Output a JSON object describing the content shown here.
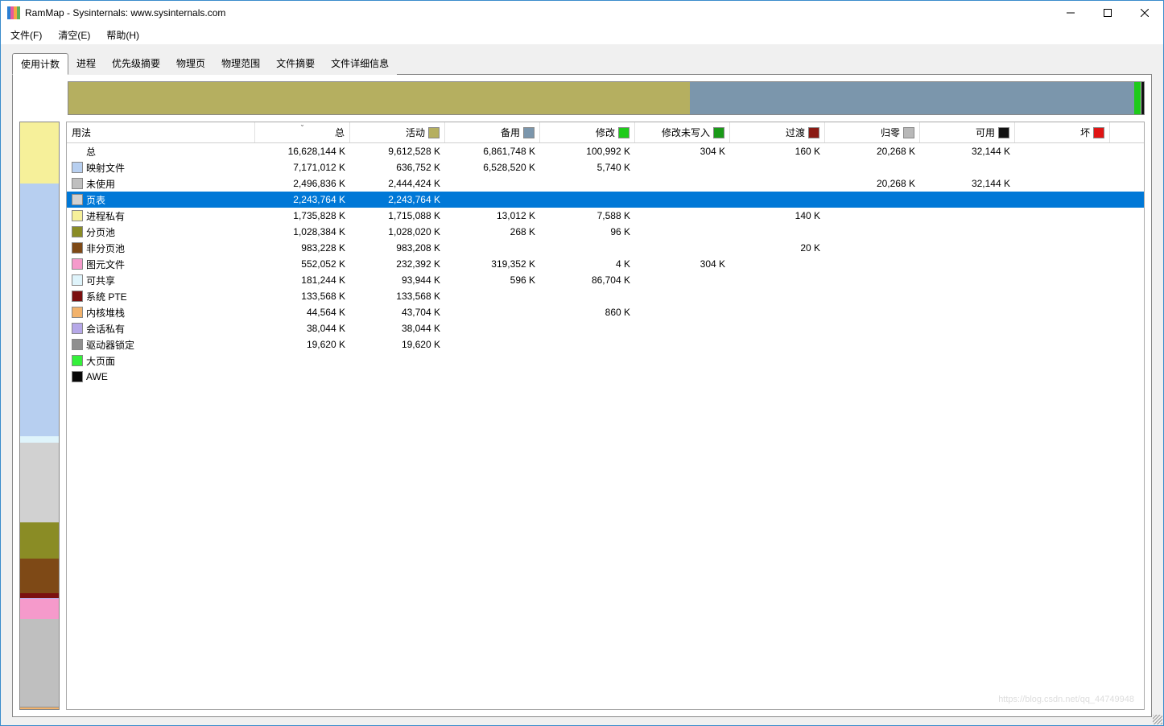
{
  "window": {
    "title": "RamMap - Sysinternals: www.sysinternals.com"
  },
  "menubar": {
    "file": "文件(F)",
    "empty": "清空(E)",
    "help": "帮助(H)"
  },
  "tabs": {
    "use_counts": "使用计数",
    "processes": "进程",
    "priority_summary": "优先级摘要",
    "physical_pages": "物理页",
    "physical_ranges": "物理范围",
    "file_summary": "文件摘要",
    "file_details": "文件详细信息"
  },
  "headers": {
    "usage": "用法",
    "total": "总",
    "active": "活动",
    "standby": "备用",
    "modified": "修改",
    "modified_nowrite": "修改未写入",
    "transition": "过渡",
    "zeroed": "归零",
    "free": "可用",
    "bad": "坏"
  },
  "colors": {
    "active": "#b5af60",
    "standby": "#7b96ac",
    "modified": "#1ecb1a",
    "modified_nowrite": "#1a9a18",
    "transition": "#8a1a13",
    "zeroed": "#b8b8b8",
    "free": "#111111",
    "bad": "#e01414",
    "mapped_file": "#b7cff0",
    "unused": "#bfbfbf",
    "page_table": "#d1d1d1",
    "process_private": "#f6f09a",
    "paged_pool": "#8a8c25",
    "nonpaged_pool": "#7e4916",
    "metafile": "#f59acb",
    "shareable": "#dff4fb",
    "system_pte": "#7b1010",
    "kernel_stack": "#f2b26b",
    "session_private": "#b6a8e8",
    "driver_locked": "#8f8f8f",
    "large_page": "#34f03a",
    "awe": "#070707"
  },
  "selected_row": 3,
  "rows": [
    {
      "name": "总",
      "color": null,
      "total": "16,628,144 K",
      "active": "9,612,528 K",
      "standby": "6,861,748 K",
      "modified": "100,992 K",
      "modified_nowrite": "304 K",
      "transition": "160 K",
      "zeroed": "20,268 K",
      "free": "32,144 K",
      "bad": ""
    },
    {
      "name": "映射文件",
      "color": "mapped_file",
      "total": "7,171,012 K",
      "active": "636,752 K",
      "standby": "6,528,520 K",
      "modified": "5,740 K",
      "modified_nowrite": "",
      "transition": "",
      "zeroed": "",
      "free": "",
      "bad": ""
    },
    {
      "name": "未使用",
      "color": "unused",
      "total": "2,496,836 K",
      "active": "2,444,424 K",
      "standby": "",
      "modified": "",
      "modified_nowrite": "",
      "transition": "",
      "zeroed": "20,268 K",
      "free": "32,144 K",
      "bad": ""
    },
    {
      "name": "页表",
      "color": "page_table",
      "total": "2,243,764 K",
      "active": "2,243,764 K",
      "standby": "",
      "modified": "",
      "modified_nowrite": "",
      "transition": "",
      "zeroed": "",
      "free": "",
      "bad": ""
    },
    {
      "name": "进程私有",
      "color": "process_private",
      "total": "1,735,828 K",
      "active": "1,715,088 K",
      "standby": "13,012 K",
      "modified": "7,588 K",
      "modified_nowrite": "",
      "transition": "140 K",
      "zeroed": "",
      "free": "",
      "bad": ""
    },
    {
      "name": "分页池",
      "color": "paged_pool",
      "total": "1,028,384 K",
      "active": "1,028,020 K",
      "standby": "268 K",
      "modified": "96 K",
      "modified_nowrite": "",
      "transition": "",
      "zeroed": "",
      "free": "",
      "bad": ""
    },
    {
      "name": "非分页池",
      "color": "nonpaged_pool",
      "total": "983,228 K",
      "active": "983,208 K",
      "standby": "",
      "modified": "",
      "modified_nowrite": "",
      "transition": "20 K",
      "zeroed": "",
      "free": "",
      "bad": ""
    },
    {
      "name": "图元文件",
      "color": "metafile",
      "total": "552,052 K",
      "active": "232,392 K",
      "standby": "319,352 K",
      "modified": "4 K",
      "modified_nowrite": "304 K",
      "transition": "",
      "zeroed": "",
      "free": "",
      "bad": ""
    },
    {
      "name": "可共享",
      "color": "shareable",
      "total": "181,244 K",
      "active": "93,944 K",
      "standby": "596 K",
      "modified": "86,704 K",
      "modified_nowrite": "",
      "transition": "",
      "zeroed": "",
      "free": "",
      "bad": ""
    },
    {
      "name": "系统 PTE",
      "color": "system_pte",
      "total": "133,568 K",
      "active": "133,568 K",
      "standby": "",
      "modified": "",
      "modified_nowrite": "",
      "transition": "",
      "zeroed": "",
      "free": "",
      "bad": ""
    },
    {
      "name": "内核堆栈",
      "color": "kernel_stack",
      "total": "44,564 K",
      "active": "43,704 K",
      "standby": "",
      "modified": "860 K",
      "modified_nowrite": "",
      "transition": "",
      "zeroed": "",
      "free": "",
      "bad": ""
    },
    {
      "name": "会话私有",
      "color": "session_private",
      "total": "38,044 K",
      "active": "38,044 K",
      "standby": "",
      "modified": "",
      "modified_nowrite": "",
      "transition": "",
      "zeroed": "",
      "free": "",
      "bad": ""
    },
    {
      "name": "驱动器锁定",
      "color": "driver_locked",
      "total": "19,620 K",
      "active": "19,620 K",
      "standby": "",
      "modified": "",
      "modified_nowrite": "",
      "transition": "",
      "zeroed": "",
      "free": "",
      "bad": ""
    },
    {
      "name": "大页面",
      "color": "large_page",
      "total": "",
      "active": "",
      "standby": "",
      "modified": "",
      "modified_nowrite": "",
      "transition": "",
      "zeroed": "",
      "free": "",
      "bad": ""
    },
    {
      "name": "AWE",
      "color": "awe",
      "total": "",
      "active": "",
      "standby": "",
      "modified": "",
      "modified_nowrite": "",
      "transition": "",
      "zeroed": "",
      "free": "",
      "bad": ""
    }
  ],
  "chart_data": {
    "horizontal_bar": {
      "type": "bar",
      "title": "用法 (总)",
      "unit": "K",
      "total": 16628144,
      "series": [
        {
          "name": "活动",
          "value": 9612528,
          "color_key": "active"
        },
        {
          "name": "备用",
          "value": 6861748,
          "color_key": "standby"
        },
        {
          "name": "修改",
          "value": 100992,
          "color_key": "modified"
        },
        {
          "name": "修改未写入",
          "value": 304,
          "color_key": "modified_nowrite"
        },
        {
          "name": "过渡",
          "value": 160,
          "color_key": "transition"
        },
        {
          "name": "归零",
          "value": 20268,
          "color_key": "zeroed"
        },
        {
          "name": "可用",
          "value": 32144,
          "color_key": "free"
        }
      ]
    },
    "vertical_bar": {
      "type": "bar",
      "title": "用法 (类别)",
      "unit": "K",
      "total": 16628144,
      "series": [
        {
          "name": "进程私有",
          "value": 1735828,
          "color_key": "process_private"
        },
        {
          "name": "映射文件",
          "value": 7171012,
          "color_key": "mapped_file"
        },
        {
          "name": "可共享",
          "value": 181244,
          "color_key": "shareable"
        },
        {
          "name": "页表",
          "value": 2243764,
          "color_key": "page_table"
        },
        {
          "name": "分页池",
          "value": 1028384,
          "color_key": "paged_pool"
        },
        {
          "name": "非分页池",
          "value": 983228,
          "color_key": "nonpaged_pool"
        },
        {
          "name": "系统 PTE",
          "value": 133568,
          "color_key": "system_pte"
        },
        {
          "name": "会话私有",
          "value": 38044,
          "color_key": "session_private"
        },
        {
          "name": "图元文件",
          "value": 552052,
          "color_key": "metafile"
        },
        {
          "name": "未使用",
          "value": 2496836,
          "color_key": "unused"
        },
        {
          "name": "驱动器锁定",
          "value": 19620,
          "color_key": "driver_locked"
        },
        {
          "name": "内核堆栈",
          "value": 44564,
          "color_key": "kernel_stack"
        }
      ]
    }
  },
  "watermark": "https://blog.csdn.net/qq_44749948"
}
